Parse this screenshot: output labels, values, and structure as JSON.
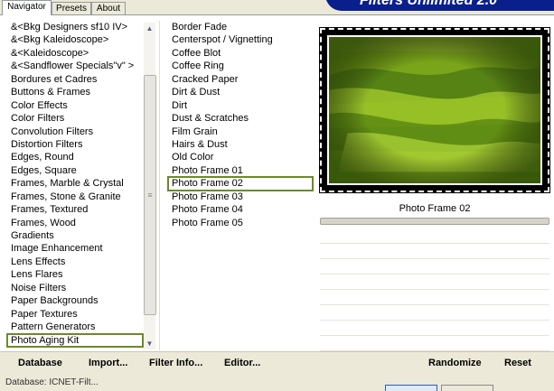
{
  "tabs": [
    "Navigator",
    "Presets",
    "About"
  ],
  "banner": "Filters Unlimited 2.0",
  "categories": [
    "&<Bkg Designers sf10 IV>",
    "&<Bkg Kaleidoscope>",
    "&<Kaleidoscope>",
    "&<Sandflower Specials\"v\" >",
    "Bordures et Cadres",
    "Buttons & Frames",
    "Color Effects",
    "Color Filters",
    "Convolution Filters",
    "Distortion Filters",
    "Edges, Round",
    "Edges, Square",
    "Frames, Marble & Crystal",
    "Frames, Stone & Granite",
    "Frames, Textured",
    "Frames, Wood",
    "Gradients",
    "Image Enhancement",
    "Lens Effects",
    "Lens Flares",
    "Noise Filters",
    "Paper Backgrounds",
    "Paper Textures",
    "Pattern Generators",
    "Photo Aging Kit"
  ],
  "selected_category": "Photo Aging Kit",
  "filters": [
    "Border Fade",
    "Centerspot / Vignetting",
    "Coffee Blot",
    "Coffee Ring",
    "Cracked Paper",
    "Dirt & Dust",
    "Dirt",
    "Dust & Scratches",
    "Film Grain",
    "Hairs & Dust",
    "Old Color",
    "Photo Frame 01",
    "Photo Frame 02",
    "Photo Frame 03",
    "Photo Frame 04",
    "Photo Frame 05"
  ],
  "selected_filter": "Photo Frame 02",
  "preview_title": "Photo Frame 02",
  "buttons": {
    "database": "Database",
    "import": "Import...",
    "filter_info": "Filter Info...",
    "editor": "Editor...",
    "randomize": "Randomize",
    "reset": "Reset"
  },
  "status_text": "Database: ICNET-Filt...",
  "colors": {
    "selection_outline": "#6b8a28",
    "banner": "#0a1f8c"
  }
}
